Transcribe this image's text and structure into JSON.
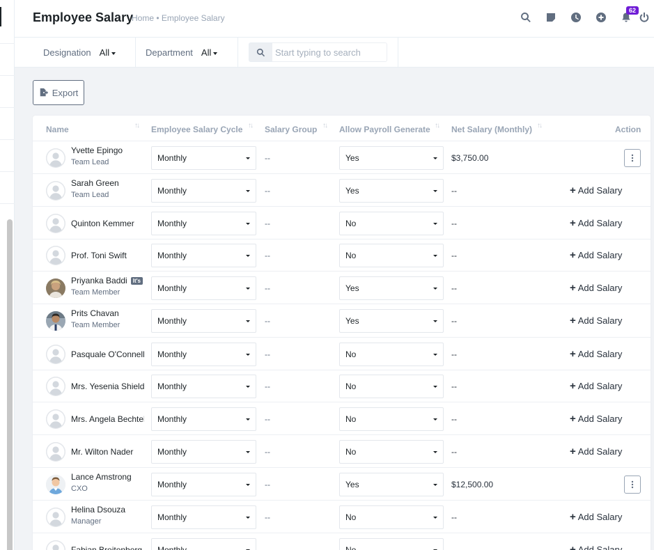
{
  "header": {
    "title": "Employee Salary",
    "breadcrumb": "Home • Employee Salary",
    "icons": [
      "search-icon",
      "sticky-note-icon",
      "clock-icon",
      "plus-circle-icon",
      "bell-icon",
      "power-icon"
    ],
    "notification_count": "62"
  },
  "filters": {
    "designation_label": "Designation",
    "designation_value": "All",
    "department_label": "Department",
    "department_value": "All",
    "search_placeholder": "Start typing to search"
  },
  "toolbar": {
    "export_label": "Export"
  },
  "table": {
    "columns": [
      "Name",
      "Employee Salary Cycle",
      "Salary Group",
      "Allow Payroll Generate",
      "Net Salary (Monthly)",
      "Action"
    ],
    "add_salary_label": "Add Salary",
    "rows": [
      {
        "name": "Yvette Epingo",
        "role": "Team Lead",
        "cycle": "Monthly",
        "group": "--",
        "payroll": "Yes",
        "net": "$3,750.00",
        "action": "menu",
        "avatar": "default"
      },
      {
        "name": "Sarah Green",
        "role": "Team Lead",
        "cycle": "Monthly",
        "group": "--",
        "payroll": "Yes",
        "net": "--",
        "action": "add",
        "avatar": "default"
      },
      {
        "name": "Quinton Kemmer",
        "role": "",
        "cycle": "Monthly",
        "group": "--",
        "payroll": "No",
        "net": "--",
        "action": "add",
        "avatar": "default"
      },
      {
        "name": "Prof. Toni Swift",
        "role": "",
        "cycle": "Monthly",
        "group": "--",
        "payroll": "No",
        "net": "--",
        "action": "add",
        "avatar": "default"
      },
      {
        "name": "Priyanka Baddi",
        "tag": "It's",
        "role": "Team Member",
        "cycle": "Monthly",
        "group": "--",
        "payroll": "Yes",
        "net": "--",
        "action": "add",
        "avatar": "photo-woman"
      },
      {
        "name": "Prits Chavan",
        "role": "Team Member",
        "cycle": "Monthly",
        "group": "--",
        "payroll": "Yes",
        "net": "--",
        "action": "add",
        "avatar": "photo-man"
      },
      {
        "name": "Pasquale O'Connell",
        "role": "",
        "cycle": "Monthly",
        "group": "--",
        "payroll": "No",
        "net": "--",
        "action": "add",
        "avatar": "default"
      },
      {
        "name": "Mrs. Yesenia Shields",
        "role": "",
        "cycle": "Monthly",
        "group": "--",
        "payroll": "No",
        "net": "--",
        "action": "add",
        "avatar": "default"
      },
      {
        "name": "Mrs. Angela Bechtel",
        "role": "",
        "cycle": "Monthly",
        "group": "--",
        "payroll": "No",
        "net": "--",
        "action": "add",
        "avatar": "default"
      },
      {
        "name": "Mr. Wilton Nader",
        "role": "",
        "cycle": "Monthly",
        "group": "--",
        "payroll": "No",
        "net": "--",
        "action": "add",
        "avatar": "default"
      },
      {
        "name": "Lance Amstrong",
        "role": "CXO",
        "cycle": "Monthly",
        "group": "--",
        "payroll": "Yes",
        "net": "$12,500.00",
        "action": "menu",
        "avatar": "photo-cartoon"
      },
      {
        "name": "Helina Dsouza",
        "role": "Manager",
        "cycle": "Monthly",
        "group": "--",
        "payroll": "No",
        "net": "--",
        "action": "add",
        "avatar": "default"
      },
      {
        "name": "Fabian Breitenberg I",
        "role": "",
        "cycle": "Monthly",
        "group": "--",
        "payroll": "No",
        "net": "--",
        "action": "add",
        "avatar": "default"
      }
    ]
  }
}
